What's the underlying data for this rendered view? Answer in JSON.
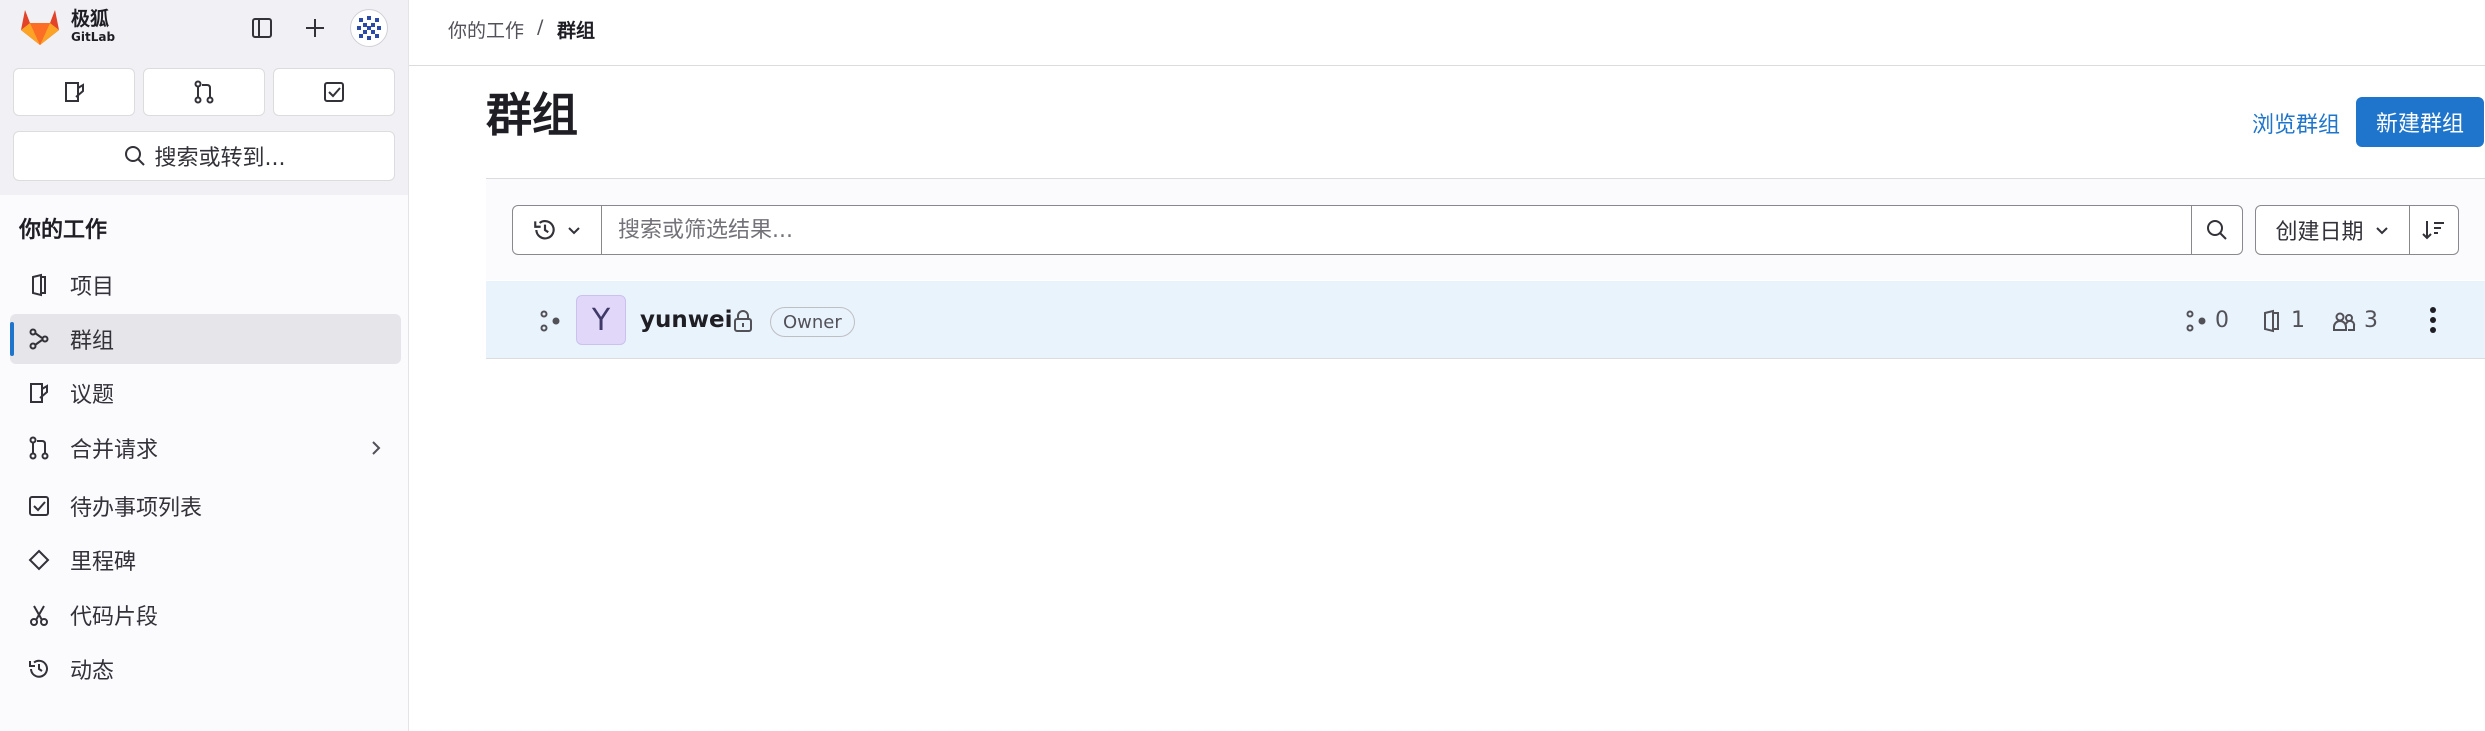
{
  "brand": {
    "name": "极狐",
    "sub": "GitLab",
    "colors": {
      "orange": "#e24329",
      "accent": "#1f75cb"
    }
  },
  "sidebar": {
    "top_icons": [
      "sidebar-toggle-icon",
      "plus-icon",
      "user-avatar"
    ],
    "quick_buttons": [
      "issues-icon",
      "merge-request-icon",
      "todo-icon"
    ],
    "search_label": "搜索或转到...",
    "section_title": "你的工作",
    "items": [
      {
        "label": "项目",
        "icon": "project-icon"
      },
      {
        "label": "群组",
        "icon": "group-icon",
        "active": true
      },
      {
        "label": "议题",
        "icon": "issues-icon"
      },
      {
        "label": "合并请求",
        "icon": "merge-request-icon"
      },
      {
        "label": "待办事项列表",
        "icon": "todo-icon"
      },
      {
        "label": "里程碑",
        "icon": "milestone-icon"
      },
      {
        "label": "代码片段",
        "icon": "snippet-icon"
      },
      {
        "label": "动态",
        "icon": "history-icon"
      }
    ]
  },
  "breadcrumb": {
    "parent": "你的工作",
    "separator": "/",
    "current": "群组"
  },
  "page": {
    "title": "群组",
    "explore_label": "浏览群组",
    "new_label": "新建群组"
  },
  "filter": {
    "placeholder": "搜索或筛选结果...",
    "sort_label": "创建日期"
  },
  "groups": [
    {
      "avatar_letter": "Y",
      "name": "yunwei",
      "visibility": "private",
      "role": "Owner",
      "subgroups": "0",
      "projects": "1",
      "members": "3"
    }
  ]
}
